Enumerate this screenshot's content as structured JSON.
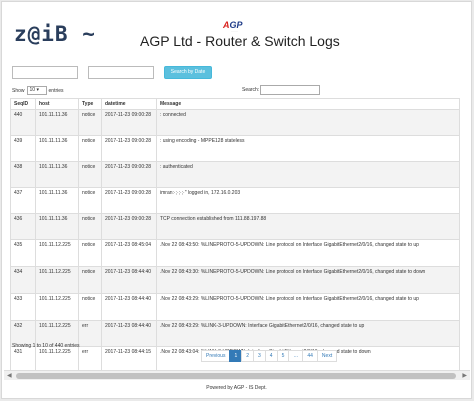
{
  "brand": "z@iB ~",
  "logo": {
    "red": "A",
    "blue": "GP",
    "sub": "·······"
  },
  "title": "AGP Ltd - Router & Switch Logs",
  "filters": {
    "search_label": "Search by Date"
  },
  "length": {
    "show": "Show",
    "value": "10",
    "entries": "entries"
  },
  "search": {
    "label": "Search:"
  },
  "table": {
    "headers": [
      "SeqID",
      "host",
      "Type",
      "datetime",
      "Message"
    ],
    "rows": [
      [
        "440",
        "101.11.11.36",
        "notice",
        "2017-11-23 09:00:28",
        ": connected"
      ],
      [
        "439",
        "101.11.11.36",
        "notice",
        "2017-11-23 09:00:28",
        ": using encoding - MPPE128 stateless"
      ],
      [
        "438",
        "101.11.11.36",
        "notice",
        "2017-11-23 09:00:28",
        ": authenticated"
      ],
      [
        "437",
        "101.11.11.36",
        "notice",
        "2017-11-23 09:00:28",
        "imran:·;·;·;·\" logged in, 172.16.0.203"
      ],
      [
        "436",
        "101.11.11.36",
        "notice",
        "2017-11-23 09:00:28",
        "TCP connection established from 111.88.197.88"
      ],
      [
        "435",
        "101.11.12.225",
        "notice",
        "2017-11-23 08:45:04",
        ".Nov 22 08:43:50: %LINEPROTO-5-UPDOWN: Line protocol on Interface GigabitEthernet2/0/16, changed state to up"
      ],
      [
        "434",
        "101.11.12.225",
        "notice",
        "2017-11-23 08:44:40",
        ".Nov 22 08:43:30: %LINEPROTO-5-UPDOWN: Line protocol on Interface GigabitEthernet2/0/16, changed state to down"
      ],
      [
        "433",
        "101.11.12.225",
        "notice",
        "2017-11-23 08:44:40",
        ".Nov 22 08:43:29: %LINEPROTO-5-UPDOWN: Line protocol on Interface GigabitEthernet2/0/16, changed state to up"
      ],
      [
        "432",
        "101.11.12.225",
        "err",
        "2017-11-23 08:44:40",
        ".Nov 22 08:43:29: %LINK-3-UPDOWN: Interface GigabitEthernet2/0/16, changed state to up"
      ],
      [
        "431",
        "101.11.12.225",
        "err",
        "2017-11-23 08:44:15",
        ".Nov 22 08:43:04: %LINK-3-UPDOWN: Interface GigabitEthernet2/0/16, changed state to down"
      ]
    ]
  },
  "info": "Showing 1 to 10 of 440 entries",
  "pagination": {
    "previous": "Previous",
    "pages": [
      "1",
      "2",
      "3",
      "4",
      "5",
      "…",
      "44"
    ],
    "next": "Next",
    "active": "1"
  },
  "footer": "Powered by AGP - IS Dept.",
  "colors": {
    "accent": "#5bc0de",
    "pager_active": "#337ab7"
  }
}
